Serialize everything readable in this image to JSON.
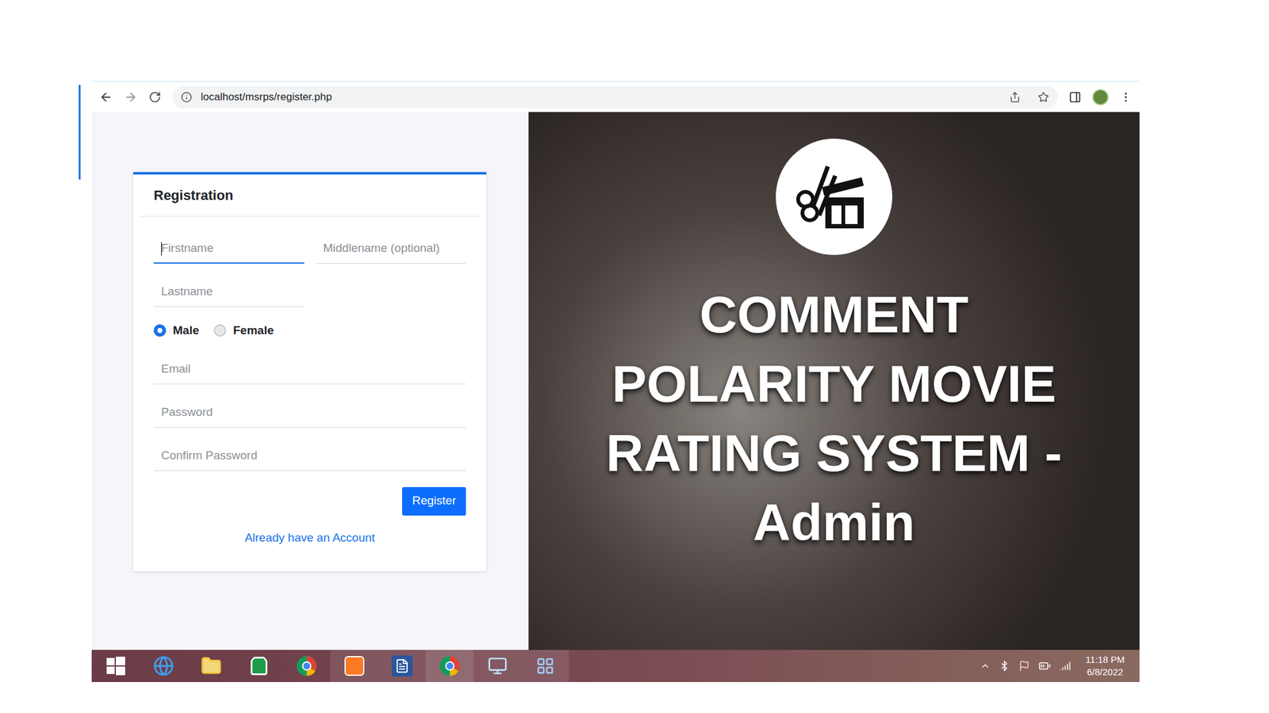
{
  "browser": {
    "url": "localhost/msrps/register.php"
  },
  "form": {
    "title": "Registration",
    "fields": [
      {
        "placeholder": "Firstname",
        "focused": true
      },
      {
        "placeholder": "Middlename (optional)",
        "focused": false
      },
      {
        "placeholder": "Lastname",
        "focused": false
      },
      {
        "placeholder": "Email",
        "focused": false
      },
      {
        "placeholder": "Password",
        "focused": false
      },
      {
        "placeholder": "Confirm Password",
        "focused": false
      }
    ],
    "gender": [
      {
        "label": "Male",
        "selected": true
      },
      {
        "label": "Female",
        "selected": false
      }
    ],
    "submit": "Register",
    "login_link": "Already have an Account"
  },
  "banner": {
    "lines": [
      "COMMENT",
      "POLARITY MOVIE",
      "RATING SYSTEM -",
      "Admin"
    ]
  },
  "taskbar": {
    "time": "11:18 PM",
    "date": "6/8/2022"
  }
}
